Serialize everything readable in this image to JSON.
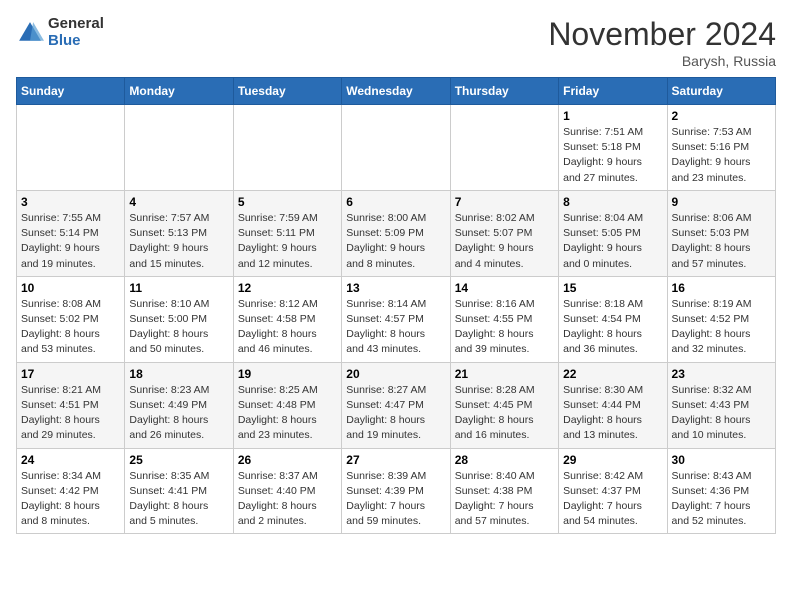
{
  "logo": {
    "general": "General",
    "blue": "Blue"
  },
  "title": "November 2024",
  "location": "Barysh, Russia",
  "days_header": [
    "Sunday",
    "Monday",
    "Tuesday",
    "Wednesday",
    "Thursday",
    "Friday",
    "Saturday"
  ],
  "weeks": [
    [
      {
        "day": "",
        "info": ""
      },
      {
        "day": "",
        "info": ""
      },
      {
        "day": "",
        "info": ""
      },
      {
        "day": "",
        "info": ""
      },
      {
        "day": "",
        "info": ""
      },
      {
        "day": "1",
        "info": "Sunrise: 7:51 AM\nSunset: 5:18 PM\nDaylight: 9 hours\nand 27 minutes."
      },
      {
        "day": "2",
        "info": "Sunrise: 7:53 AM\nSunset: 5:16 PM\nDaylight: 9 hours\nand 23 minutes."
      }
    ],
    [
      {
        "day": "3",
        "info": "Sunrise: 7:55 AM\nSunset: 5:14 PM\nDaylight: 9 hours\nand 19 minutes."
      },
      {
        "day": "4",
        "info": "Sunrise: 7:57 AM\nSunset: 5:13 PM\nDaylight: 9 hours\nand 15 minutes."
      },
      {
        "day": "5",
        "info": "Sunrise: 7:59 AM\nSunset: 5:11 PM\nDaylight: 9 hours\nand 12 minutes."
      },
      {
        "day": "6",
        "info": "Sunrise: 8:00 AM\nSunset: 5:09 PM\nDaylight: 9 hours\nand 8 minutes."
      },
      {
        "day": "7",
        "info": "Sunrise: 8:02 AM\nSunset: 5:07 PM\nDaylight: 9 hours\nand 4 minutes."
      },
      {
        "day": "8",
        "info": "Sunrise: 8:04 AM\nSunset: 5:05 PM\nDaylight: 9 hours\nand 0 minutes."
      },
      {
        "day": "9",
        "info": "Sunrise: 8:06 AM\nSunset: 5:03 PM\nDaylight: 8 hours\nand 57 minutes."
      }
    ],
    [
      {
        "day": "10",
        "info": "Sunrise: 8:08 AM\nSunset: 5:02 PM\nDaylight: 8 hours\nand 53 minutes."
      },
      {
        "day": "11",
        "info": "Sunrise: 8:10 AM\nSunset: 5:00 PM\nDaylight: 8 hours\nand 50 minutes."
      },
      {
        "day": "12",
        "info": "Sunrise: 8:12 AM\nSunset: 4:58 PM\nDaylight: 8 hours\nand 46 minutes."
      },
      {
        "day": "13",
        "info": "Sunrise: 8:14 AM\nSunset: 4:57 PM\nDaylight: 8 hours\nand 43 minutes."
      },
      {
        "day": "14",
        "info": "Sunrise: 8:16 AM\nSunset: 4:55 PM\nDaylight: 8 hours\nand 39 minutes."
      },
      {
        "day": "15",
        "info": "Sunrise: 8:18 AM\nSunset: 4:54 PM\nDaylight: 8 hours\nand 36 minutes."
      },
      {
        "day": "16",
        "info": "Sunrise: 8:19 AM\nSunset: 4:52 PM\nDaylight: 8 hours\nand 32 minutes."
      }
    ],
    [
      {
        "day": "17",
        "info": "Sunrise: 8:21 AM\nSunset: 4:51 PM\nDaylight: 8 hours\nand 29 minutes."
      },
      {
        "day": "18",
        "info": "Sunrise: 8:23 AM\nSunset: 4:49 PM\nDaylight: 8 hours\nand 26 minutes."
      },
      {
        "day": "19",
        "info": "Sunrise: 8:25 AM\nSunset: 4:48 PM\nDaylight: 8 hours\nand 23 minutes."
      },
      {
        "day": "20",
        "info": "Sunrise: 8:27 AM\nSunset: 4:47 PM\nDaylight: 8 hours\nand 19 minutes."
      },
      {
        "day": "21",
        "info": "Sunrise: 8:28 AM\nSunset: 4:45 PM\nDaylight: 8 hours\nand 16 minutes."
      },
      {
        "day": "22",
        "info": "Sunrise: 8:30 AM\nSunset: 4:44 PM\nDaylight: 8 hours\nand 13 minutes."
      },
      {
        "day": "23",
        "info": "Sunrise: 8:32 AM\nSunset: 4:43 PM\nDaylight: 8 hours\nand 10 minutes."
      }
    ],
    [
      {
        "day": "24",
        "info": "Sunrise: 8:34 AM\nSunset: 4:42 PM\nDaylight: 8 hours\nand 8 minutes."
      },
      {
        "day": "25",
        "info": "Sunrise: 8:35 AM\nSunset: 4:41 PM\nDaylight: 8 hours\nand 5 minutes."
      },
      {
        "day": "26",
        "info": "Sunrise: 8:37 AM\nSunset: 4:40 PM\nDaylight: 8 hours\nand 2 minutes."
      },
      {
        "day": "27",
        "info": "Sunrise: 8:39 AM\nSunset: 4:39 PM\nDaylight: 7 hours\nand 59 minutes."
      },
      {
        "day": "28",
        "info": "Sunrise: 8:40 AM\nSunset: 4:38 PM\nDaylight: 7 hours\nand 57 minutes."
      },
      {
        "day": "29",
        "info": "Sunrise: 8:42 AM\nSunset: 4:37 PM\nDaylight: 7 hours\nand 54 minutes."
      },
      {
        "day": "30",
        "info": "Sunrise: 8:43 AM\nSunset: 4:36 PM\nDaylight: 7 hours\nand 52 minutes."
      }
    ]
  ]
}
